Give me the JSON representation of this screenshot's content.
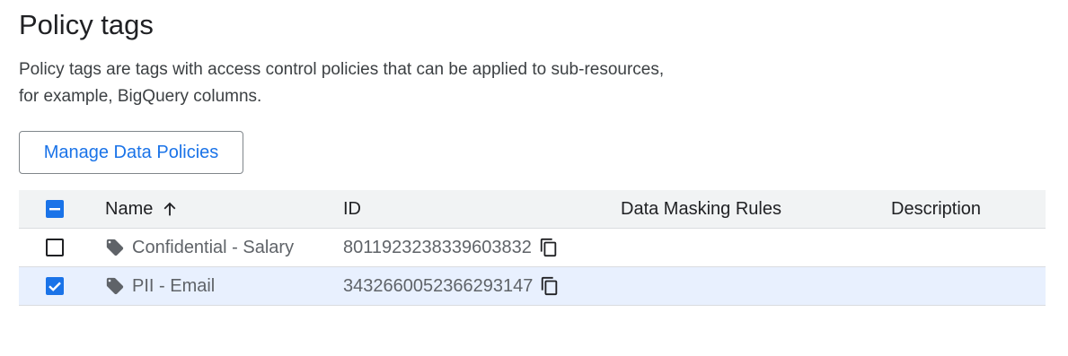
{
  "page": {
    "title": "Policy tags",
    "description": "Policy tags are tags with access control policies that can be applied to sub-resources, for example, BigQuery columns."
  },
  "toolbar": {
    "manage_label": "Manage Data Policies"
  },
  "table": {
    "header": {
      "select_state": "indeterminate",
      "name": "Name",
      "sort_icon": "arrow-up-icon",
      "id": "ID",
      "masking": "Data Masking Rules",
      "description": "Description"
    },
    "rows": [
      {
        "checked": false,
        "icon": "tag-icon",
        "name": "Confidential - Salary",
        "id": "8011923238339603832",
        "masking": "",
        "description": ""
      },
      {
        "checked": true,
        "icon": "tag-icon",
        "name": "PII - Email",
        "id": "3432660052366293147",
        "masking": "",
        "description": ""
      }
    ]
  },
  "colors": {
    "accent": "#1a73e8",
    "header_bg": "#f1f3f4",
    "selected_row_bg": "#e8f0fe"
  }
}
